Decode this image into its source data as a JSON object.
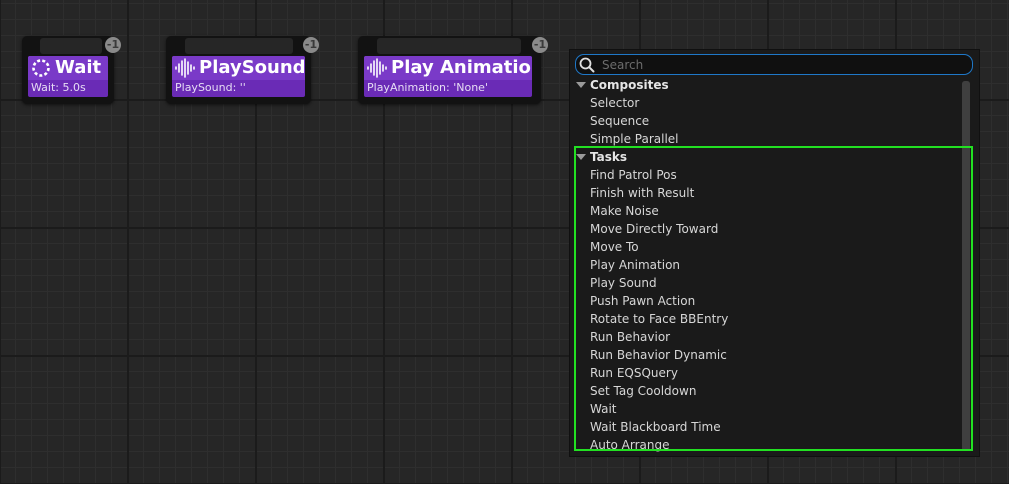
{
  "nodes": {
    "wait": {
      "title": "Wait",
      "subtitle": "Wait: 5.0s",
      "icon": "wait-circle-icon",
      "badge": "-1"
    },
    "play_sound": {
      "title": "PlaySound",
      "subtitle": "PlaySound: ''",
      "icon": "waveform-icon",
      "badge": "-1"
    },
    "play_animation": {
      "title": "Play Animation",
      "subtitle": "PlayAnimation: 'None'",
      "icon": "waveform-icon",
      "badge": "-1"
    }
  },
  "menu": {
    "search": {
      "placeholder": "Search",
      "value": ""
    },
    "categories": [
      {
        "label": "Composites",
        "items": [
          "Selector",
          "Sequence",
          "Simple Parallel"
        ]
      },
      {
        "label": "Tasks",
        "items": [
          "Find Patrol Pos",
          "Finish with Result",
          "Make Noise",
          "Move Directly Toward",
          "Move To",
          "Play Animation",
          "Play Sound",
          "Push Pawn Action",
          "Rotate to Face BBEntry",
          "Run Behavior",
          "Run Behavior Dynamic",
          "Run EQSQuery",
          "Set Tag Cooldown",
          "Wait",
          "Wait Blackboard Time",
          "Auto Arrange"
        ]
      }
    ]
  },
  "colors": {
    "node_purple": "#7a3ac8",
    "highlight_green": "#22e022",
    "search_border": "#1f78c8"
  }
}
